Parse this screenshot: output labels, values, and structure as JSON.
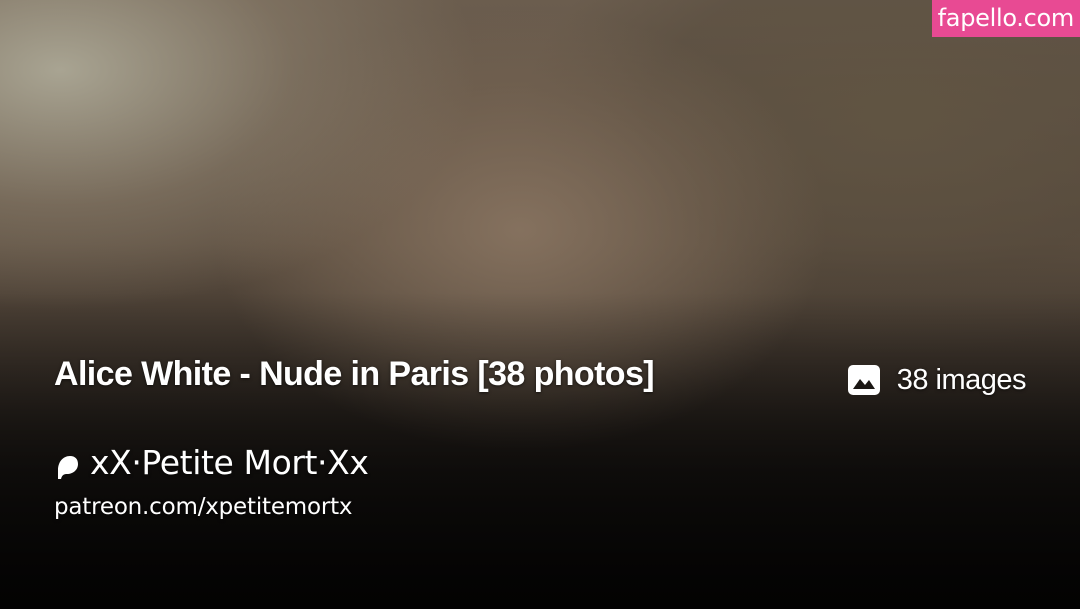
{
  "site": {
    "watermark": "fapello.com",
    "accent_color": "#e84a93"
  },
  "post": {
    "title": "Alice White - Nude in Paris [38 photos]",
    "image_count_label": "38 images",
    "image_icon": "image-icon"
  },
  "creator": {
    "name": "xX·Petite Mort·Xx",
    "platform_icon": "patreon-icon",
    "url": "patreon.com/xpetitemortx"
  }
}
